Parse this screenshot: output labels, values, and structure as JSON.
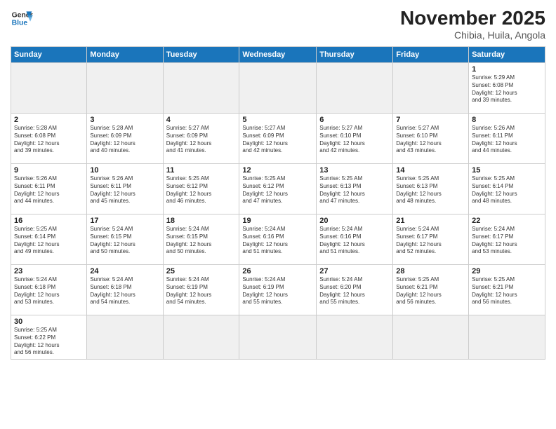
{
  "header": {
    "logo_general": "General",
    "logo_blue": "Blue",
    "month_title": "November 2025",
    "subtitle": "Chibia, Huila, Angola"
  },
  "weekdays": [
    "Sunday",
    "Monday",
    "Tuesday",
    "Wednesday",
    "Thursday",
    "Friday",
    "Saturday"
  ],
  "weeks": [
    [
      {
        "day": "",
        "info": ""
      },
      {
        "day": "",
        "info": ""
      },
      {
        "day": "",
        "info": ""
      },
      {
        "day": "",
        "info": ""
      },
      {
        "day": "",
        "info": ""
      },
      {
        "day": "",
        "info": ""
      },
      {
        "day": "1",
        "info": "Sunrise: 5:29 AM\nSunset: 6:08 PM\nDaylight: 12 hours\nand 39 minutes."
      }
    ],
    [
      {
        "day": "2",
        "info": "Sunrise: 5:28 AM\nSunset: 6:08 PM\nDaylight: 12 hours\nand 39 minutes."
      },
      {
        "day": "3",
        "info": "Sunrise: 5:28 AM\nSunset: 6:09 PM\nDaylight: 12 hours\nand 40 minutes."
      },
      {
        "day": "4",
        "info": "Sunrise: 5:27 AM\nSunset: 6:09 PM\nDaylight: 12 hours\nand 41 minutes."
      },
      {
        "day": "5",
        "info": "Sunrise: 5:27 AM\nSunset: 6:09 PM\nDaylight: 12 hours\nand 42 minutes."
      },
      {
        "day": "6",
        "info": "Sunrise: 5:27 AM\nSunset: 6:10 PM\nDaylight: 12 hours\nand 42 minutes."
      },
      {
        "day": "7",
        "info": "Sunrise: 5:27 AM\nSunset: 6:10 PM\nDaylight: 12 hours\nand 43 minutes."
      },
      {
        "day": "8",
        "info": "Sunrise: 5:26 AM\nSunset: 6:11 PM\nDaylight: 12 hours\nand 44 minutes."
      }
    ],
    [
      {
        "day": "9",
        "info": "Sunrise: 5:26 AM\nSunset: 6:11 PM\nDaylight: 12 hours\nand 44 minutes."
      },
      {
        "day": "10",
        "info": "Sunrise: 5:26 AM\nSunset: 6:11 PM\nDaylight: 12 hours\nand 45 minutes."
      },
      {
        "day": "11",
        "info": "Sunrise: 5:25 AM\nSunset: 6:12 PM\nDaylight: 12 hours\nand 46 minutes."
      },
      {
        "day": "12",
        "info": "Sunrise: 5:25 AM\nSunset: 6:12 PM\nDaylight: 12 hours\nand 47 minutes."
      },
      {
        "day": "13",
        "info": "Sunrise: 5:25 AM\nSunset: 6:13 PM\nDaylight: 12 hours\nand 47 minutes."
      },
      {
        "day": "14",
        "info": "Sunrise: 5:25 AM\nSunset: 6:13 PM\nDaylight: 12 hours\nand 48 minutes."
      },
      {
        "day": "15",
        "info": "Sunrise: 5:25 AM\nSunset: 6:14 PM\nDaylight: 12 hours\nand 48 minutes."
      }
    ],
    [
      {
        "day": "16",
        "info": "Sunrise: 5:25 AM\nSunset: 6:14 PM\nDaylight: 12 hours\nand 49 minutes."
      },
      {
        "day": "17",
        "info": "Sunrise: 5:24 AM\nSunset: 6:15 PM\nDaylight: 12 hours\nand 50 minutes."
      },
      {
        "day": "18",
        "info": "Sunrise: 5:24 AM\nSunset: 6:15 PM\nDaylight: 12 hours\nand 50 minutes."
      },
      {
        "day": "19",
        "info": "Sunrise: 5:24 AM\nSunset: 6:16 PM\nDaylight: 12 hours\nand 51 minutes."
      },
      {
        "day": "20",
        "info": "Sunrise: 5:24 AM\nSunset: 6:16 PM\nDaylight: 12 hours\nand 51 minutes."
      },
      {
        "day": "21",
        "info": "Sunrise: 5:24 AM\nSunset: 6:17 PM\nDaylight: 12 hours\nand 52 minutes."
      },
      {
        "day": "22",
        "info": "Sunrise: 5:24 AM\nSunset: 6:17 PM\nDaylight: 12 hours\nand 53 minutes."
      }
    ],
    [
      {
        "day": "23",
        "info": "Sunrise: 5:24 AM\nSunset: 6:18 PM\nDaylight: 12 hours\nand 53 minutes."
      },
      {
        "day": "24",
        "info": "Sunrise: 5:24 AM\nSunset: 6:18 PM\nDaylight: 12 hours\nand 54 minutes."
      },
      {
        "day": "25",
        "info": "Sunrise: 5:24 AM\nSunset: 6:19 PM\nDaylight: 12 hours\nand 54 minutes."
      },
      {
        "day": "26",
        "info": "Sunrise: 5:24 AM\nSunset: 6:19 PM\nDaylight: 12 hours\nand 55 minutes."
      },
      {
        "day": "27",
        "info": "Sunrise: 5:24 AM\nSunset: 6:20 PM\nDaylight: 12 hours\nand 55 minutes."
      },
      {
        "day": "28",
        "info": "Sunrise: 5:25 AM\nSunset: 6:21 PM\nDaylight: 12 hours\nand 56 minutes."
      },
      {
        "day": "29",
        "info": "Sunrise: 5:25 AM\nSunset: 6:21 PM\nDaylight: 12 hours\nand 56 minutes."
      }
    ],
    [
      {
        "day": "30",
        "info": "Sunrise: 5:25 AM\nSunset: 6:22 PM\nDaylight: 12 hours\nand 56 minutes."
      },
      {
        "day": "",
        "info": ""
      },
      {
        "day": "",
        "info": ""
      },
      {
        "day": "",
        "info": ""
      },
      {
        "day": "",
        "info": ""
      },
      {
        "day": "",
        "info": ""
      },
      {
        "day": "",
        "info": ""
      }
    ]
  ]
}
